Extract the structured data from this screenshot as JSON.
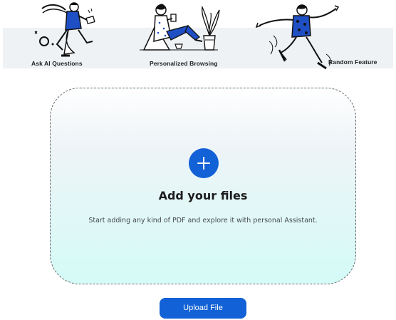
{
  "features": [
    {
      "label": "Ask AI Questions",
      "icon": "person-throwing-paper-illustration"
    },
    {
      "label": "Personalized Browsing",
      "icon": "person-reading-on-floor-illustration"
    },
    {
      "label": "Random Feature",
      "icon": "person-running-illustration"
    }
  ],
  "dropzone": {
    "add_icon": "plus-icon",
    "title": "Add your files",
    "subtitle": "Start adding any kind of PDF and explore it with personal Assistant."
  },
  "upload_button": {
    "label": "Upload File"
  },
  "colors": {
    "accent": "#1261d6",
    "banner_bg": "#eef2f5",
    "dropzone_bottom": "#d4fbf7"
  }
}
